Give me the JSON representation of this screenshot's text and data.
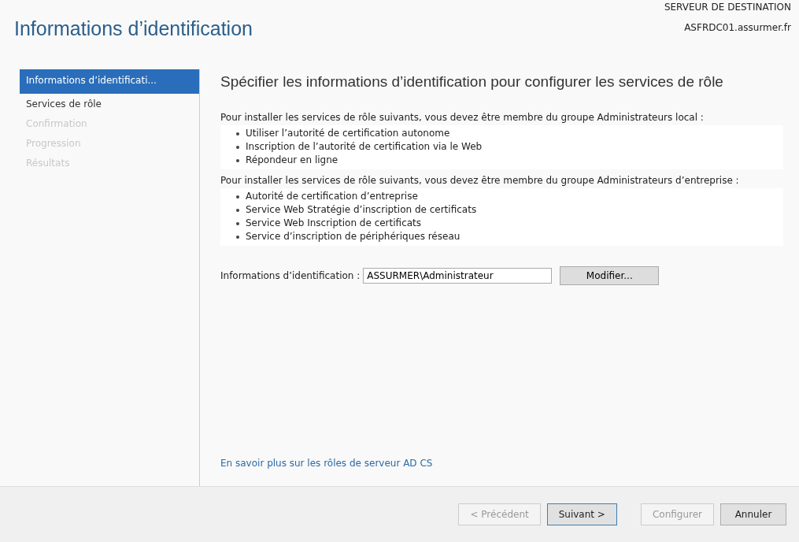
{
  "window": {
    "title": "Informations d’identification"
  },
  "destination": {
    "label": "SERVEUR DE DESTINATION",
    "server": "ASFRDC01.assurmer.fr"
  },
  "sidebar": {
    "items": [
      {
        "label": "Informations d’identificati...",
        "selected": true,
        "disabled": false
      },
      {
        "label": "Services de rôle",
        "selected": false,
        "disabled": false
      },
      {
        "label": "Confirmation",
        "selected": false,
        "disabled": true
      },
      {
        "label": "Progression",
        "selected": false,
        "disabled": true
      },
      {
        "label": "Résultats",
        "selected": false,
        "disabled": true
      }
    ]
  },
  "content": {
    "heading": "Spécifier les informations d’identification pour configurer les services de rôle",
    "groups": [
      {
        "intro": "Pour installer les services de rôle suivants, vous devez être membre du groupe Administrateurs local :",
        "items": [
          "Utiliser l’autorité de certification autonome",
          "Inscription de l’autorité de certification via le Web",
          "Répondeur en ligne"
        ]
      },
      {
        "intro": "Pour installer les services de rôle suivants, vous devez être membre du groupe Administrateurs d’entreprise :",
        "items": [
          "Autorité de certification d’entreprise",
          "Service Web Stratégie d’inscription de certificats",
          "Service Web Inscription de certificats",
          "Service d’inscription de périphériques réseau"
        ]
      }
    ],
    "credentials": {
      "label": "Informations d’identification :",
      "value": "ASSURMER\\Administrateur",
      "button": "Modifier..."
    },
    "link": "En savoir plus sur les rôles de serveur AD CS"
  },
  "buttons": [
    {
      "label": "< Précédent",
      "disabled": true,
      "default": false
    },
    {
      "label": "Suivant >",
      "disabled": false,
      "default": true
    },
    {
      "label": "Configurer",
      "disabled": true,
      "default": false
    },
    {
      "label": "Annuler",
      "disabled": false,
      "default": false
    }
  ]
}
